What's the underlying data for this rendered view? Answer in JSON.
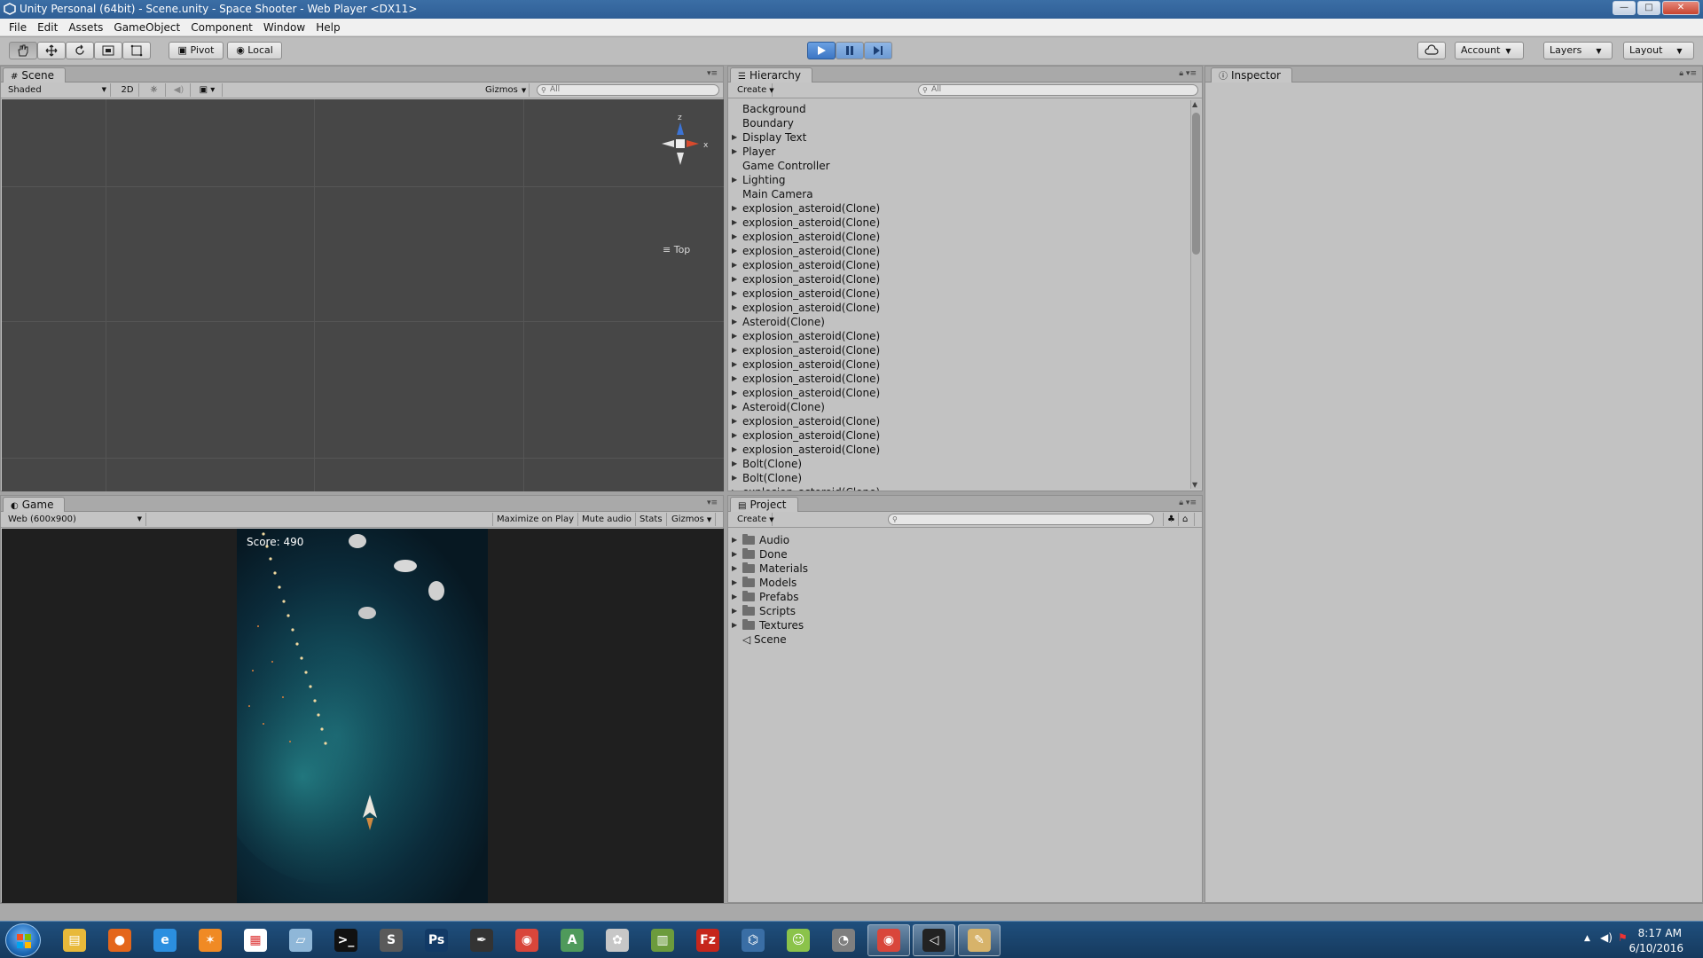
{
  "window": {
    "title": "Unity Personal (64bit) - Scene.unity - Space Shooter - Web Player <DX11>"
  },
  "menu": [
    "File",
    "Edit",
    "Assets",
    "GameObject",
    "Component",
    "Window",
    "Help"
  ],
  "toolbar": {
    "pivot_label": "Pivot",
    "local_label": "Local",
    "account_label": "Account",
    "layers_label": "Layers",
    "layout_label": "Layout"
  },
  "scene": {
    "tab_label": "Scene",
    "shading_mode": "Shaded",
    "toggle_2d": "2D",
    "gizmos_label": "Gizmos",
    "search_placeholder": "All",
    "view_label": "Top",
    "gizmo_axes": {
      "z": "z",
      "x": "x"
    }
  },
  "game": {
    "tab_label": "Game",
    "resolution": "Web (600x900)",
    "maximize_label": "Maximize on Play",
    "mute_label": "Mute audio",
    "stats_label": "Stats",
    "gizmos_label": "Gizmos",
    "score_text": "Score: 490"
  },
  "hierarchy": {
    "tab_label": "Hierarchy",
    "create_label": "Create",
    "search_placeholder": "All",
    "items": [
      {
        "label": "Background",
        "expandable": false
      },
      {
        "label": "Boundary",
        "expandable": false
      },
      {
        "label": "Display Text",
        "expandable": true
      },
      {
        "label": "Player",
        "expandable": true
      },
      {
        "label": "Game Controller",
        "expandable": false
      },
      {
        "label": "Lighting",
        "expandable": true
      },
      {
        "label": "Main Camera",
        "expandable": false
      },
      {
        "label": "explosion_asteroid(Clone)",
        "expandable": true
      },
      {
        "label": "explosion_asteroid(Clone)",
        "expandable": true
      },
      {
        "label": "explosion_asteroid(Clone)",
        "expandable": true
      },
      {
        "label": "explosion_asteroid(Clone)",
        "expandable": true
      },
      {
        "label": "explosion_asteroid(Clone)",
        "expandable": true
      },
      {
        "label": "explosion_asteroid(Clone)",
        "expandable": true
      },
      {
        "label": "explosion_asteroid(Clone)",
        "expandable": true
      },
      {
        "label": "explosion_asteroid(Clone)",
        "expandable": true
      },
      {
        "label": "Asteroid(Clone)",
        "expandable": true
      },
      {
        "label": "explosion_asteroid(Clone)",
        "expandable": true
      },
      {
        "label": "explosion_asteroid(Clone)",
        "expandable": true
      },
      {
        "label": "explosion_asteroid(Clone)",
        "expandable": true
      },
      {
        "label": "explosion_asteroid(Clone)",
        "expandable": true
      },
      {
        "label": "explosion_asteroid(Clone)",
        "expandable": true
      },
      {
        "label": "Asteroid(Clone)",
        "expandable": true
      },
      {
        "label": "explosion_asteroid(Clone)",
        "expandable": true
      },
      {
        "label": "explosion_asteroid(Clone)",
        "expandable": true
      },
      {
        "label": "explosion_asteroid(Clone)",
        "expandable": true
      },
      {
        "label": "Bolt(Clone)",
        "expandable": true
      },
      {
        "label": "Bolt(Clone)",
        "expandable": true
      },
      {
        "label": "explosion_asteroid(Clone)",
        "expandable": true
      }
    ]
  },
  "project": {
    "tab_label": "Project",
    "create_label": "Create",
    "folders": [
      "Audio",
      "Done",
      "Materials",
      "Models",
      "Prefabs",
      "Scripts",
      "Textures"
    ],
    "scene_item": "Scene"
  },
  "inspector": {
    "tab_label": "Inspector"
  },
  "taskbar": {
    "apps": [
      "windows-explorer-icon",
      "firefox-icon",
      "internet-explorer-icon",
      "blender-icon",
      "app-grid-icon",
      "notepad-icon",
      "terminal-icon",
      "sublime-text-icon",
      "photoshop-icon",
      "inkscape-icon",
      "chrome-icon",
      "android-studio-icon",
      "paint-icon",
      "spreadsheet-icon",
      "filezilla-icon",
      "python-icon",
      "android-icon",
      "game-icon",
      "chrome-icon",
      "unity-icon",
      "paint-tools-icon"
    ],
    "clock_time": "8:17 AM",
    "clock_date": "6/10/2016"
  },
  "colors": {
    "titlebar": "#3b6ea5",
    "play_active": "#3c76c4",
    "editor_bg": "#c2c2c2",
    "scene_bg": "#474747",
    "taskbar": "#1f4f7d"
  }
}
